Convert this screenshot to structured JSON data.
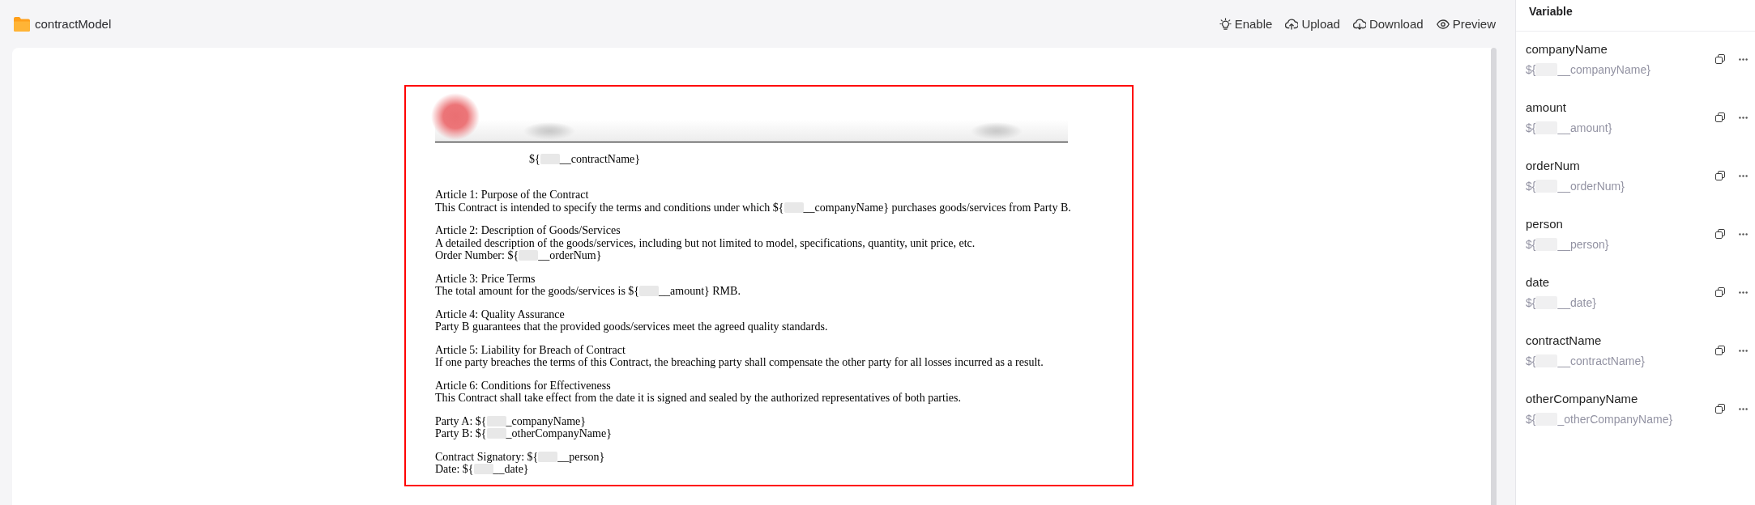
{
  "header": {
    "title": "contractModel",
    "actions": [
      {
        "kind": "enable",
        "label": "Enable"
      },
      {
        "kind": "upload",
        "label": "Upload"
      },
      {
        "kind": "download",
        "label": "Download"
      },
      {
        "kind": "preview",
        "label": "Preview"
      }
    ]
  },
  "document": {
    "title": [
      {
        "kind": "text",
        "text": "${"
      },
      {
        "kind": "redacted"
      },
      {
        "kind": "text",
        "text": "__contractName}"
      }
    ],
    "sections": [
      {
        "heading": "Article 1: Purpose of the Contract",
        "lines": [
          [
            {
              "kind": "text",
              "text": "This Contract is intended to specify the terms and conditions under which ${"
            },
            {
              "kind": "redacted"
            },
            {
              "kind": "text",
              "text": "__companyName} purchases goods/services from Party B."
            }
          ]
        ]
      },
      {
        "heading": "Article 2: Description of Goods/Services",
        "lines": [
          [
            {
              "kind": "text",
              "text": "A detailed description of the goods/services, including but not limited to model, specifications, quantity, unit price, etc."
            }
          ],
          [
            {
              "kind": "text",
              "text": "Order Number: ${"
            },
            {
              "kind": "redacted"
            },
            {
              "kind": "text",
              "text": "__orderNum}"
            }
          ]
        ]
      },
      {
        "heading": "Article 3: Price Terms",
        "lines": [
          [
            {
              "kind": "text",
              "text": "The total amount for the goods/services is ${"
            },
            {
              "kind": "redacted"
            },
            {
              "kind": "text",
              "text": "__amount} RMB."
            }
          ]
        ]
      },
      {
        "heading": "Article 4: Quality Assurance",
        "lines": [
          [
            {
              "kind": "text",
              "text": "Party B guarantees that the provided goods/services meet the agreed quality standards."
            }
          ]
        ]
      },
      {
        "heading": "Article 5: Liability for Breach of Contract",
        "lines": [
          [
            {
              "kind": "text",
              "text": "If one party breaches the terms of this Contract, the breaching party shall compensate the other party for all losses incurred as a result."
            }
          ]
        ]
      },
      {
        "heading": "Article 6: Conditions for Effectiveness",
        "lines": [
          [
            {
              "kind": "text",
              "text": "This Contract shall take effect from the date it is signed and sealed by the authorized representatives of both parties."
            }
          ]
        ]
      },
      {
        "lines": [
          [
            {
              "kind": "text",
              "text": "Party A: ${"
            },
            {
              "kind": "redacted"
            },
            {
              "kind": "text",
              "text": "_companyName}"
            }
          ],
          [
            {
              "kind": "text",
              "text": "Party B: ${"
            },
            {
              "kind": "redacted"
            },
            {
              "kind": "text",
              "text": "_otherCompanyName}"
            }
          ]
        ]
      },
      {
        "lines": [
          [
            {
              "kind": "text",
              "text": "Contract Signatory: ${"
            },
            {
              "kind": "redacted"
            },
            {
              "kind": "text",
              "text": "__person}"
            }
          ],
          [
            {
              "kind": "text",
              "text": "Date: ${"
            },
            {
              "kind": "redacted"
            },
            {
              "kind": "text",
              "text": "__date}"
            }
          ]
        ]
      }
    ]
  },
  "variable_panel": {
    "title": "Variable",
    "variables": [
      {
        "name": "companyName",
        "value": [
          {
            "kind": "text",
            "text": "${"
          },
          {
            "kind": "redacted"
          },
          {
            "kind": "text",
            "text": "__companyName}"
          }
        ]
      },
      {
        "name": "amount",
        "value": [
          {
            "kind": "text",
            "text": "${"
          },
          {
            "kind": "redacted"
          },
          {
            "kind": "text",
            "text": "__amount}"
          }
        ]
      },
      {
        "name": "orderNum",
        "value": [
          {
            "kind": "text",
            "text": "${"
          },
          {
            "kind": "redacted"
          },
          {
            "kind": "text",
            "text": "__orderNum}"
          }
        ]
      },
      {
        "name": "person",
        "value": [
          {
            "kind": "text",
            "text": "${"
          },
          {
            "kind": "redacted"
          },
          {
            "kind": "text",
            "text": "__person}"
          }
        ]
      },
      {
        "name": "date",
        "value": [
          {
            "kind": "text",
            "text": "${"
          },
          {
            "kind": "redacted"
          },
          {
            "kind": "text",
            "text": "__date}"
          }
        ]
      },
      {
        "name": "contractName",
        "value": [
          {
            "kind": "text",
            "text": "${"
          },
          {
            "kind": "redacted"
          },
          {
            "kind": "text",
            "text": "__contractName}"
          }
        ]
      },
      {
        "name": "otherCompanyName",
        "value": [
          {
            "kind": "text",
            "text": "${"
          },
          {
            "kind": "redacted"
          },
          {
            "kind": "text",
            "text": "_otherCompanyName}"
          }
        ]
      }
    ]
  }
}
